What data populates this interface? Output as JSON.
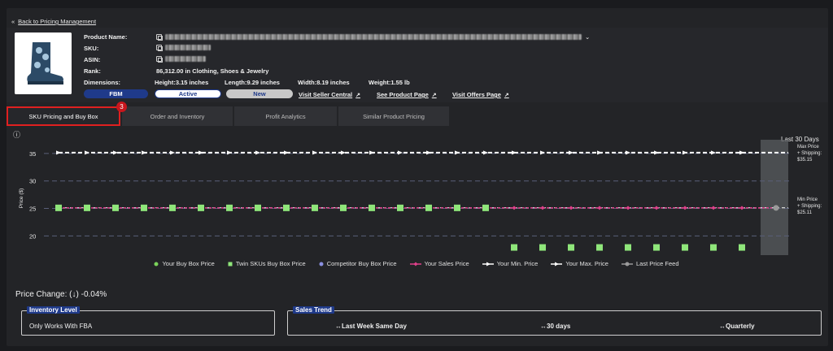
{
  "nav": {
    "back_arrow": "«",
    "back_label": "Back to Pricing Management"
  },
  "product": {
    "name_label": "Product Name:",
    "sku_label": "SKU:",
    "asin_label": "ASIN:",
    "rank_label": "Rank:",
    "rank_value": "86,312.00 in Clothing, Shoes & Jewelry",
    "dimensions_label": "Dimensions:",
    "height": "Height:3.15 inches",
    "length": "Length:9.29 inches",
    "width": "Width:8.19 inches",
    "weight": "Weight:1.55 lb",
    "chevron": "⌄"
  },
  "badges": {
    "fulfillment": "FBM",
    "status": "Active",
    "condition": "New"
  },
  "links": {
    "seller_central": "Visit Seller Central",
    "product_page": "See Product Page",
    "offers_page": "Visit Offers Page",
    "ext_glyph": "↗"
  },
  "tabs": [
    {
      "label": "SKU Pricing and Buy Box"
    },
    {
      "label": "Order and Inventory"
    },
    {
      "label": "Profit Analytics"
    },
    {
      "label": "Similar Product Pricing"
    }
  ],
  "tab_badge": "3",
  "chart_data": {
    "type": "line",
    "ylabel": "Price ($)",
    "yticks": [
      20,
      25,
      30,
      35
    ],
    "ylim": [
      16.5,
      37.5
    ],
    "period_label": "Last 30 Days",
    "info_glyph": "ⓘ",
    "max_annotation": [
      "Max Price",
      "+ Shipping:",
      "$35.15"
    ],
    "min_annotation": [
      "Min Price",
      "+ Shipping:",
      "$25.11"
    ],
    "x_count": 25,
    "series": [
      {
        "name": "Your Buy Box Price",
        "color": "#7bd35a",
        "values": []
      },
      {
        "name": "Twin SKUs Buy Box Price",
        "color": "#8fe67a",
        "values": [
          25.1,
          25.1,
          25.1,
          25.1,
          25.1,
          25.1,
          25.1,
          25.1,
          25.1,
          25.1,
          25.1,
          25.1,
          25.1,
          25.1,
          25.1,
          25.1,
          17.9,
          17.9,
          17.9,
          17.9,
          17.9,
          17.9,
          17.9,
          17.9,
          17.9
        ]
      },
      {
        "name": "Competitor Buy Box Price",
        "color": "#8a8fe0",
        "values": []
      },
      {
        "name": "Your Sales Price",
        "color": "#e0408a",
        "value_constant": 25.1
      },
      {
        "name": "Your Min. Price",
        "color": "#ffffff",
        "value_constant": 25.11
      },
      {
        "name": "Your Max. Price",
        "color": "#ffffff",
        "value_constant": 35.15
      },
      {
        "name": "Last Price Feed",
        "color": "#9a9a9a",
        "value_constant": 25.1
      }
    ]
  },
  "price_change": {
    "label": "Price Change:",
    "arrow": "(↓)",
    "value": "-0.04%"
  },
  "inventory": {
    "title": "Inventory Level",
    "text": "Only Works With FBA"
  },
  "sales_trend": {
    "title": "Sales Trend",
    "items": [
      "↔Last Week Same Day",
      "↔30 days",
      "↔Quarterly"
    ]
  }
}
